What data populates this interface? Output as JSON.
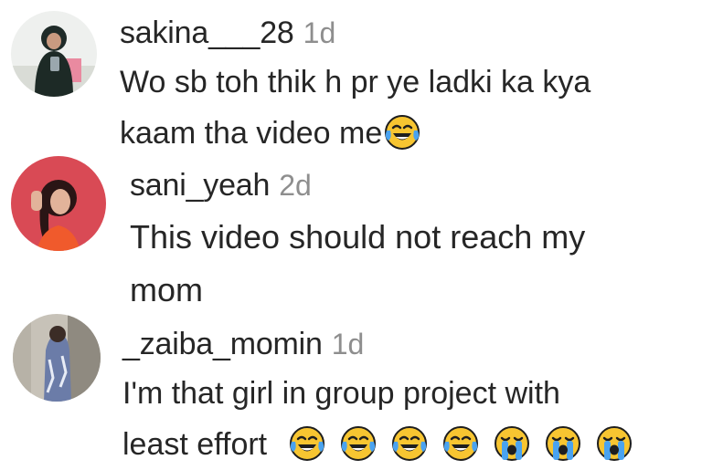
{
  "comments": [
    {
      "username": "sakina___28",
      "time": "1d",
      "lines": [
        "Wo sb toh thik h pr ye ladki ka kya",
        "kaam tha video me"
      ],
      "trailing_emojis": [
        "face-with-tears-of-joy"
      ]
    },
    {
      "username": "sani_yeah",
      "time": "2d",
      "lines": [
        "This video should not reach my",
        "mom"
      ],
      "trailing_emojis": []
    },
    {
      "username": "_zaiba_momin",
      "time": "1d",
      "lines": [
        "I'm that girl in group project with",
        "least effort"
      ],
      "trailing_emojis": [
        "face-with-tears-of-joy",
        "face-with-tears-of-joy",
        "face-with-tears-of-joy",
        "face-with-tears-of-joy",
        "loudly-crying-face",
        "loudly-crying-face",
        "loudly-crying-face"
      ]
    }
  ],
  "colors": {
    "username": "#262626",
    "timestamp": "#8e8e8e",
    "text": "#262626",
    "emoji_face": "#f7c531",
    "emoji_tears": "#4aa3f0"
  }
}
